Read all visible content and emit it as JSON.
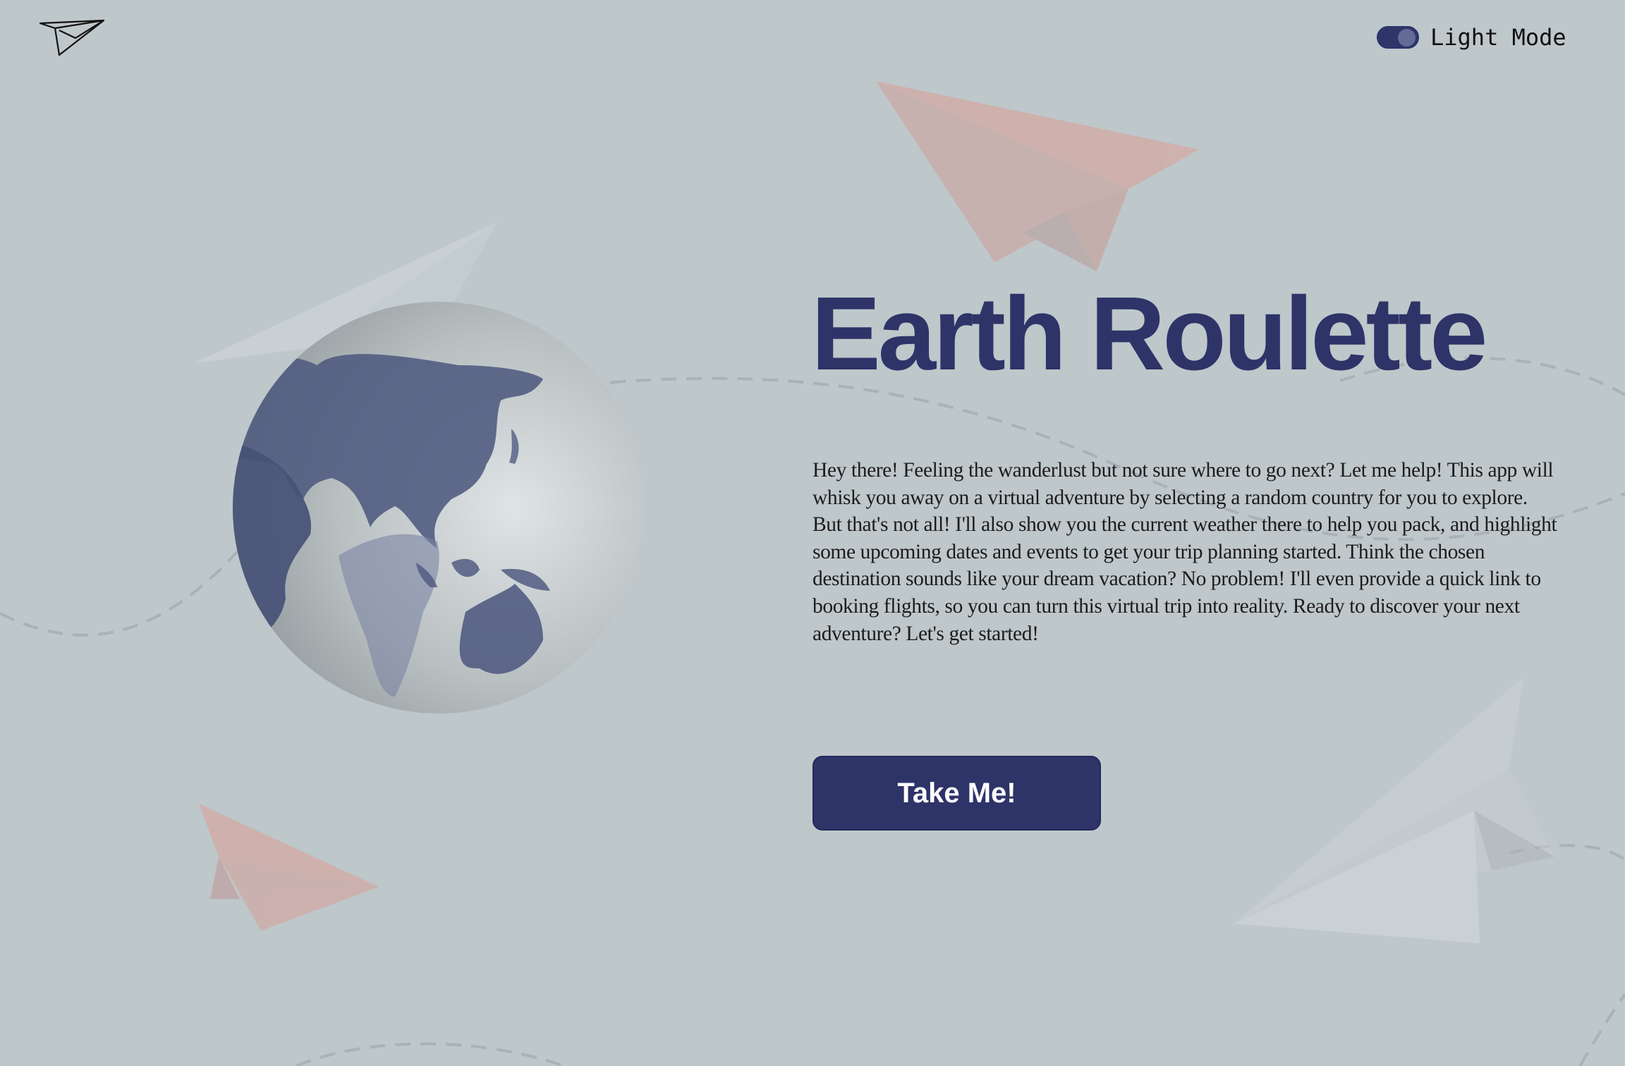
{
  "header": {
    "logo_icon": "paper-plane-icon",
    "theme_toggle": {
      "label": "Light Mode",
      "state": "on",
      "color": "#2f3569"
    }
  },
  "hero": {
    "title": "Earth Roulette",
    "paragraph1": "Hey there! Feeling the wanderlust but not sure where to go next? Let me help! This app will whisk you away on a virtual adventure by selecting a random country for you to explore.",
    "paragraph2": "But that's not all! I'll also show you the current weather there to help you pack, and highlight some upcoming dates and events to get your trip planning started. Think the chosen destination sounds like your dream vacation? No problem! I'll even provide a quick link to booking flights, so you can turn this virtual trip into reality. Ready to discover your next adventure? Let's get started!",
    "cta_label": "Take Me!"
  },
  "colors": {
    "background": "#bec7ca",
    "accent": "#2e3468",
    "plane_pink": "#d4a9a3"
  }
}
